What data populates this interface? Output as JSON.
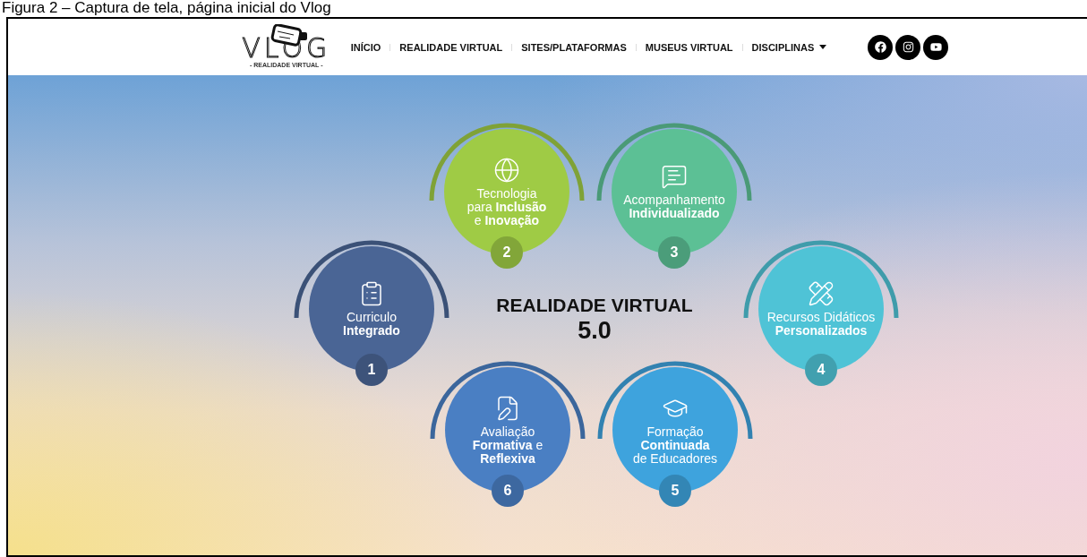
{
  "caption": "Figura 2 – Captura de tela, página inicial do Vlog",
  "header": {
    "logo": {
      "text": "VLOG",
      "tagline": "- REALIDADE VIRTUAL -"
    },
    "nav": [
      {
        "label": "INÍCIO",
        "dropdown": false
      },
      {
        "label": "REALIDADE VIRTUAL",
        "dropdown": false
      },
      {
        "label": "SITES/PLATAFORMAS",
        "dropdown": false
      },
      {
        "label": "MUSEUS VIRTUAL",
        "dropdown": false
      },
      {
        "label": "DISCIPLINAS",
        "dropdown": true
      }
    ],
    "social": [
      {
        "kind": "facebook"
      },
      {
        "kind": "instagram"
      },
      {
        "kind": "youtube"
      }
    ]
  },
  "hero": {
    "title": "REALIDADE VIRTUAL",
    "subtitle": "5.0",
    "steps": [
      {
        "number": "2",
        "lines": [
          "Tecnologia",
          "para **Inclusão**",
          "e **Inovação**"
        ],
        "color": "#9fcb45"
      },
      {
        "number": "3",
        "lines": [
          "Acompanhamento",
          "**Individualizado**"
        ],
        "color": "#5cc095"
      },
      {
        "number": "1",
        "lines": [
          "Curriculo",
          "**Integrado**"
        ],
        "color": "#4a6595"
      },
      {
        "number": "4",
        "lines": [
          "Recursos Didáticos",
          "**Personalizados**"
        ],
        "color": "#4fc3d6"
      },
      {
        "number": "6",
        "lines": [
          "Avaliação",
          "**Formativa** e",
          "**Reflexiva**"
        ],
        "color": "#4a7fc3"
      },
      {
        "number": "5",
        "lines": [
          "Formação",
          "**Continuada**",
          "de Educadores"
        ],
        "color": "#3ea3dd"
      }
    ]
  }
}
